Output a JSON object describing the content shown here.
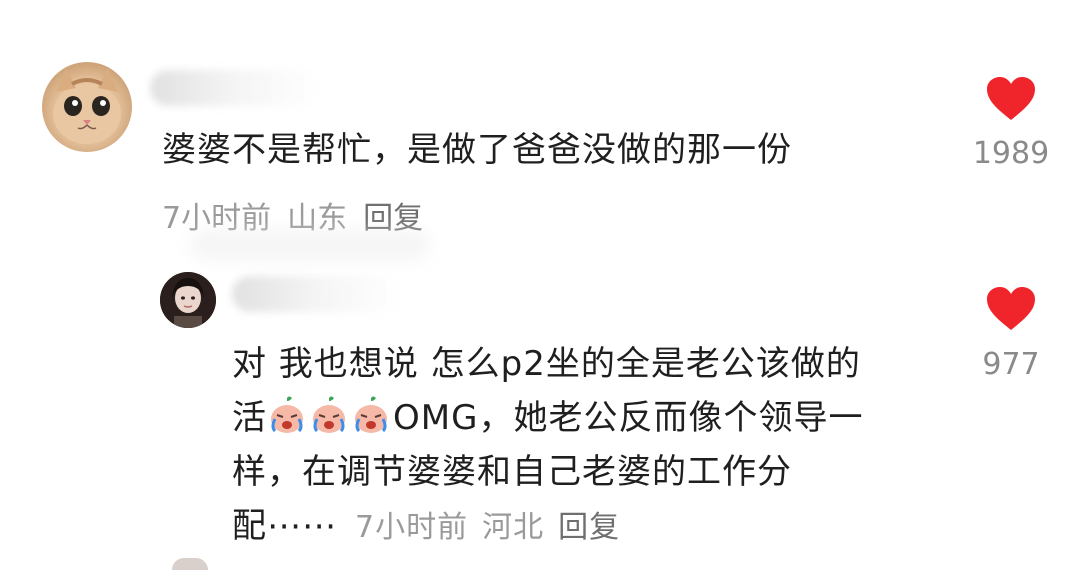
{
  "comments": [
    {
      "avatar_icon": "cat-avatar-icon",
      "text": "婆婆不是帮忙，是做了爸爸没做的那一份",
      "time": "7小时前",
      "location": "山东",
      "reply_label": "回复",
      "likes": "1989"
    }
  ],
  "reply": {
    "avatar_icon": "user-avatar-icon",
    "lines": [
      "对 我也想说 怎么p2坐的全是老公该做的",
      "OMG，她老公反而像个领导一",
      "样，在调节婆婆和自己老婆的工作分",
      "配⋯⋯"
    ],
    "line2_prefix": "活",
    "emoji_name": "crying-emoji-icon",
    "emoji_count": 3,
    "time": "7小时前",
    "location": "河北",
    "reply_label": "回复",
    "likes": "977"
  },
  "colors": {
    "heart": "#f0242b",
    "meta": "#9a9a9a",
    "text": "#1f1f1f"
  }
}
